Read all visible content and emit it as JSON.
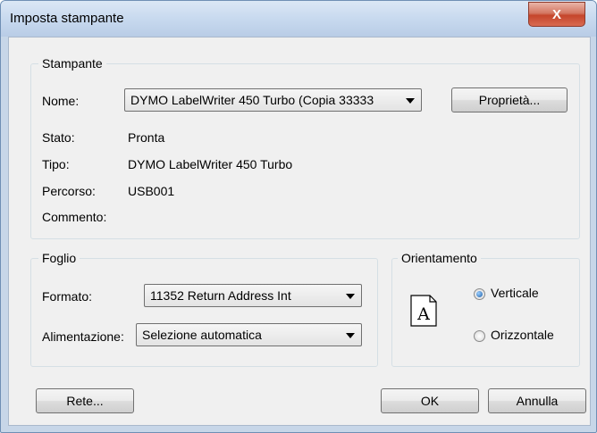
{
  "window": {
    "title": "Imposta stampante",
    "close_glyph": "X"
  },
  "printer": {
    "legend": "Stampante",
    "name_label": "Nome:",
    "name_value": "DYMO LabelWriter 450 Turbo (Copia 33333",
    "properties_label": "Proprietà...",
    "status_label": "Stato:",
    "status_value": "Pronta",
    "type_label": "Tipo:",
    "type_value": "DYMO LabelWriter 450 Turbo",
    "path_label": "Percorso:",
    "path_value": "USB001",
    "comment_label": "Commento:"
  },
  "paper": {
    "legend": "Foglio",
    "format_label": "Formato:",
    "format_value": "11352 Return Address Int",
    "source_label": "Alimentazione:",
    "source_value": "Selezione automatica"
  },
  "orientation": {
    "legend": "Orientamento",
    "page_glyph": "A",
    "portrait_label": "Verticale",
    "landscape_label": "Orizzontale",
    "selected": "portrait"
  },
  "buttons": {
    "network": "Rete...",
    "ok": "OK",
    "cancel": "Annulla"
  }
}
